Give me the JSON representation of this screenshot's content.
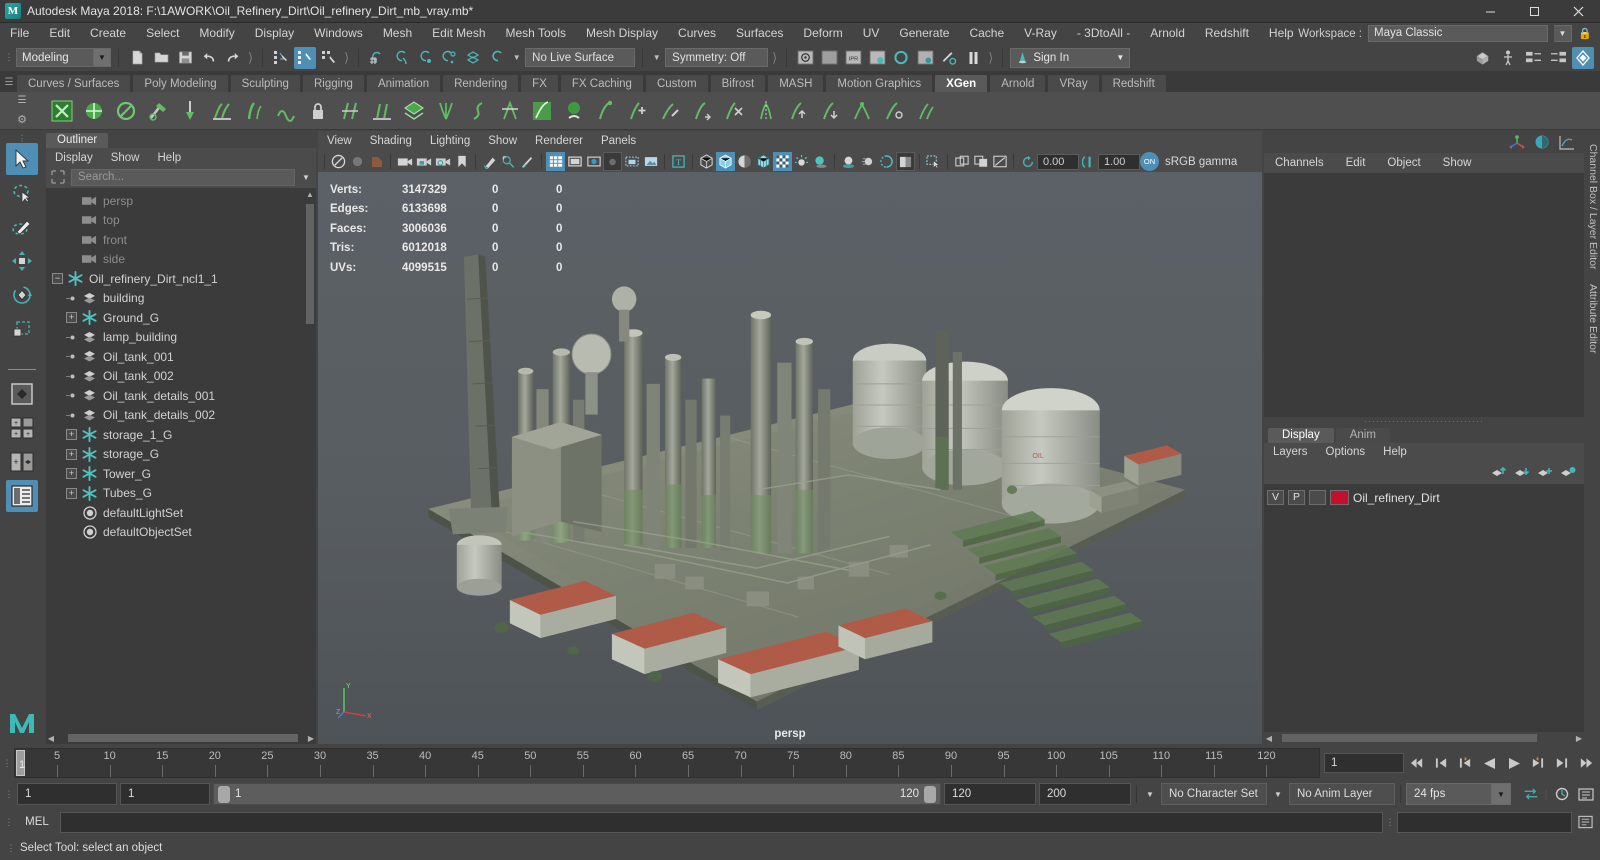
{
  "titlebar": {
    "app_title": "Autodesk Maya 2018: F:\\1AWORK\\Oil_Refinery_Dirt\\Oil_refinery_Dirt_mb_vray.mb*",
    "logo_text": "M",
    "minimize": "─",
    "maximize": "❐",
    "close": "✕"
  },
  "menubar": {
    "items": [
      "File",
      "Edit",
      "Create",
      "Select",
      "Modify",
      "Display",
      "Windows",
      "Mesh",
      "Edit Mesh",
      "Mesh Tools",
      "Mesh Display",
      "Curves",
      "Surfaces",
      "Deform",
      "UV",
      "Generate",
      "Cache",
      "V-Ray",
      "- 3DtoAll -",
      "Arnold",
      "Redshift",
      "Help"
    ],
    "workspace_label": "Workspace :",
    "workspace_value": "Maya Classic"
  },
  "statusbar": {
    "mode": "Modeling",
    "live_surface": "No Live Surface",
    "symmetry": "Symmetry: Off",
    "signin": "Sign In"
  },
  "shelf": {
    "tabs": [
      "Curves / Surfaces",
      "Poly Modeling",
      "Sculpting",
      "Rigging",
      "Animation",
      "Rendering",
      "FX",
      "FX Caching",
      "Custom",
      "Bifrost",
      "MASH",
      "Motion Graphics",
      "XGen",
      "Arnold",
      "VRay",
      "Redshift"
    ],
    "active_tab": "XGen"
  },
  "outliner": {
    "tab_title": "Outliner",
    "menus": [
      "Display",
      "Show",
      "Help"
    ],
    "search_placeholder": "Search...",
    "items": [
      {
        "label": "persp",
        "indent": 1,
        "icon": "camera-icon",
        "expander": "none",
        "dim": true
      },
      {
        "label": "top",
        "indent": 1,
        "icon": "camera-icon",
        "expander": "none",
        "dim": true
      },
      {
        "label": "front",
        "indent": 1,
        "icon": "camera-icon",
        "expander": "none",
        "dim": true
      },
      {
        "label": "side",
        "indent": 1,
        "icon": "camera-icon",
        "expander": "none",
        "dim": true
      },
      {
        "label": "Oil_refinery_Dirt_ncl1_1",
        "indent": 0,
        "icon": "group-star-icon",
        "expander": "minus",
        "dim": false
      },
      {
        "label": "building",
        "indent": 1,
        "icon": "mesh-icon",
        "expander": "leaf",
        "dim": false
      },
      {
        "label": "Ground_G",
        "indent": 1,
        "icon": "group-star-icon",
        "expander": "plus",
        "dim": false
      },
      {
        "label": "lamp_building",
        "indent": 1,
        "icon": "mesh-icon",
        "expander": "leaf",
        "dim": false
      },
      {
        "label": "Oil_tank_001",
        "indent": 1,
        "icon": "mesh-icon",
        "expander": "leaf",
        "dim": false
      },
      {
        "label": "Oil_tank_002",
        "indent": 1,
        "icon": "mesh-icon",
        "expander": "leaf",
        "dim": false
      },
      {
        "label": "Oil_tank_details_001",
        "indent": 1,
        "icon": "mesh-icon",
        "expander": "leaf",
        "dim": false
      },
      {
        "label": "Oil_tank_details_002",
        "indent": 1,
        "icon": "mesh-icon",
        "expander": "leaf",
        "dim": false
      },
      {
        "label": "storage_1_G",
        "indent": 1,
        "icon": "group-star-icon",
        "expander": "plus",
        "dim": false
      },
      {
        "label": "storage_G",
        "indent": 1,
        "icon": "group-star-icon",
        "expander": "plus",
        "dim": false
      },
      {
        "label": "Tower_G",
        "indent": 1,
        "icon": "group-star-icon",
        "expander": "plus",
        "dim": false
      },
      {
        "label": "Tubes_G",
        "indent": 1,
        "icon": "group-star-icon",
        "expander": "plus",
        "dim": false
      },
      {
        "label": "defaultLightSet",
        "indent": 1,
        "icon": "set-icon",
        "expander": "none",
        "dim": false
      },
      {
        "label": "defaultObjectSet",
        "indent": 1,
        "icon": "set-icon",
        "expander": "none",
        "dim": false
      }
    ]
  },
  "viewport": {
    "menus": [
      "View",
      "Shading",
      "Lighting",
      "Show",
      "Renderer",
      "Panels"
    ],
    "exposure": "0.00",
    "gamma_value": "1.00",
    "gamma_toggle": "ON",
    "color_space": "sRGB gamma",
    "camera_label": "persp",
    "hud": [
      {
        "label": "Verts:",
        "selected": "3147329",
        "v2": "0",
        "v3": "0"
      },
      {
        "label": "Edges:",
        "selected": "6133698",
        "v2": "0",
        "v3": "0"
      },
      {
        "label": "Faces:",
        "selected": "3006036",
        "v2": "0",
        "v3": "0"
      },
      {
        "label": "Tris:",
        "selected": "6012018",
        "v2": "0",
        "v3": "0"
      },
      {
        "label": "UVs:",
        "selected": "4099515",
        "v2": "0",
        "v3": "0"
      }
    ],
    "axis": {
      "y": "Y",
      "x": "X",
      "z": "Z"
    }
  },
  "channelbox": {
    "menus": [
      "Channels",
      "Edit",
      "Object",
      "Show"
    ]
  },
  "layer_editor": {
    "tabs": [
      "Display",
      "Anim"
    ],
    "active_tab": "Display",
    "menus": [
      "Layers",
      "Options",
      "Help"
    ],
    "columns": [
      "V",
      "P",
      ""
    ],
    "layers": [
      {
        "visible": "V",
        "playback": "P",
        "extra": "",
        "color": "#c40f2e",
        "name": "Oil_refinery_Dirt"
      }
    ]
  },
  "right_dock": {
    "labels": [
      "Channel Box / Layer Editor",
      "Attribute Editor"
    ]
  },
  "timeline": {
    "start": 1,
    "end": 120,
    "current_frame": "1",
    "major_ticks": [
      5,
      10,
      15,
      20,
      25,
      30,
      35,
      40,
      45,
      50,
      55,
      60,
      65,
      70,
      75,
      80,
      85,
      90,
      95,
      100,
      105,
      110,
      115,
      120
    ],
    "current_label": "1"
  },
  "range": {
    "anim_start": "1",
    "range_start": "1",
    "slider_start": "1",
    "slider_end": "120",
    "range_end": "120",
    "anim_end": "200",
    "character_set": "No Character Set",
    "anim_layer": "No Anim Layer",
    "fps": "24 fps"
  },
  "command_line": {
    "language": "MEL",
    "input_value": "",
    "output_value": ""
  },
  "statusline": {
    "message": "Select Tool: select an object"
  },
  "toolbox": {
    "items": [
      "select-tool",
      "lasso-select-tool",
      "paint-select-tool",
      "move-tool",
      "rotate-tool",
      "scale-tool",
      "last-tool",
      "single-pane-layout",
      "four-pane-layout",
      "two-pane-layout",
      "outliner-persp-layout"
    ]
  },
  "colors": {
    "accent": "#4f8fb5",
    "teal": "#46b5b5",
    "layer_swatch": "#c40f2e",
    "panel_bg": "#444444",
    "dark_bg": "#3b3b3b"
  }
}
